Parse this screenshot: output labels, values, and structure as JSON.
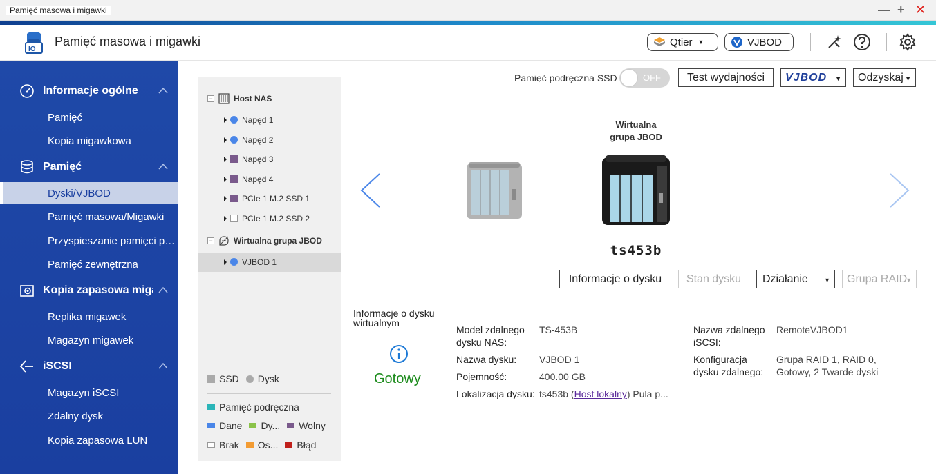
{
  "window": {
    "title": "Pamięć masowa i migawki"
  },
  "header": {
    "title": "Pamięć masowa i migawki",
    "qtier_label": "Qtier",
    "vjbod_label": "VJBOD"
  },
  "sidebar": {
    "groups": [
      {
        "label": "Informacje ogólne",
        "icon": "gauge-icon",
        "items": [
          "Pamięć",
          "Kopia migawkowa"
        ]
      },
      {
        "label": "Pamięć",
        "icon": "database-icon",
        "items": [
          "Dyski/VJBOD",
          "Pamięć masowa/Migawki",
          "Przyspieszanie pamięci podręcznej",
          "Pamięć zewnętrzna"
        ]
      },
      {
        "label": "Kopia zapasowa migawek",
        "icon": "snapshot-backup-icon",
        "items": [
          "Replika migawek",
          "Magazyn migawek"
        ]
      },
      {
        "label": "iSCSI",
        "icon": "iscsi-icon",
        "items": [
          "Magazyn iSCSI",
          "Zdalny dysk",
          "Kopia zapasowa LUN"
        ]
      }
    ],
    "active_item": "Dyski/VJBOD"
  },
  "tree": {
    "host": {
      "label": "Host NAS",
      "children": [
        "Napęd 1",
        "Napęd 2",
        "Napęd 3",
        "Napęd 4",
        "PCIe 1 M.2 SSD 1",
        "PCIe 1 M.2 SSD 2"
      ]
    },
    "virtual": {
      "label": "Wirtualna grupa JBOD",
      "children": [
        "VJBOD 1"
      ]
    }
  },
  "legend": {
    "ssd": "SSD",
    "disk": "Dysk",
    "cache": "Pamięć podręczna",
    "data": "Dane",
    "dy": "Dy...",
    "free": "Wolny",
    "none": "Brak",
    "os": "Os...",
    "error": "Błąd",
    "colors": {
      "cache": "#2bb5b8",
      "data": "#4a86e8",
      "dy": "#8bc34a",
      "free": "#7a5a8c",
      "os": "#f39c34",
      "error": "#c0201b"
    }
  },
  "toolbar": {
    "ssd_cache_label": "Pamięć podręczna SSD",
    "toggle_state": "OFF",
    "perf_test": "Test wydajności",
    "vjbod_menu": "VJBOD",
    "recover": "Odzyskaj"
  },
  "device": {
    "title_line1": "Wirtualna",
    "title_line2": "grupa JBOD",
    "name": "ts453b"
  },
  "actions": {
    "disk_info": "Informacje o dysku",
    "disk_status": "Stan dysku",
    "action": "Działanie",
    "raid_group": "Grupa RAID"
  },
  "info": {
    "caption": "Informacje o dysku wirtualnym",
    "status": "Gotowy",
    "model_key": "Model zdalnego dysku NAS:",
    "model_val": "TS-453B",
    "name_key": "Nazwa dysku:",
    "name_val": "VJBOD 1",
    "capacity_key": "Pojemność:",
    "capacity_val": "400.00 GB",
    "location_key": "Lokalizacja dysku:",
    "location_val_prefix": "ts453b (",
    "location_link": "Host lokalny",
    "location_val_suffix": ") Pula p...",
    "iscsi_key": "Nazwa zdalnego iSCSI:",
    "iscsi_val": "RemoteVJBOD1",
    "config_key": "Konfiguracja dysku zdalnego:",
    "config_val": "Grupa RAID 1, RAID 0, Gotowy, 2 Twarde dyski"
  }
}
